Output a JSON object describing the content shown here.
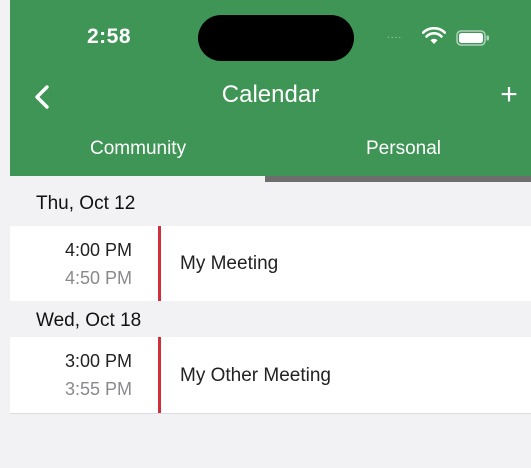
{
  "status_bar": {
    "time": "2:58",
    "signal": "....",
    "wifi_icon": "wifi-icon",
    "battery_icon": "battery-icon"
  },
  "nav": {
    "back_icon": "chevron-left-icon",
    "title": "Calendar",
    "add_label": "+"
  },
  "tabs": [
    {
      "label": "Community",
      "selected": false
    },
    {
      "label": "Personal",
      "selected": true
    }
  ],
  "days": [
    {
      "date": "Thu, Oct 12",
      "events": [
        {
          "start": "4:00 PM",
          "end": "4:50 PM",
          "title": "My Meeting"
        }
      ]
    },
    {
      "date": "Wed, Oct 18",
      "events": [
        {
          "start": "3:00 PM",
          "end": "3:55 PM",
          "title": "My Other Meeting"
        }
      ]
    }
  ],
  "colors": {
    "header_bg": "#3f9556",
    "event_accent": "#d32f3a",
    "tab_indicator": "#6e6e6e",
    "list_bg": "#f2f2f4"
  }
}
